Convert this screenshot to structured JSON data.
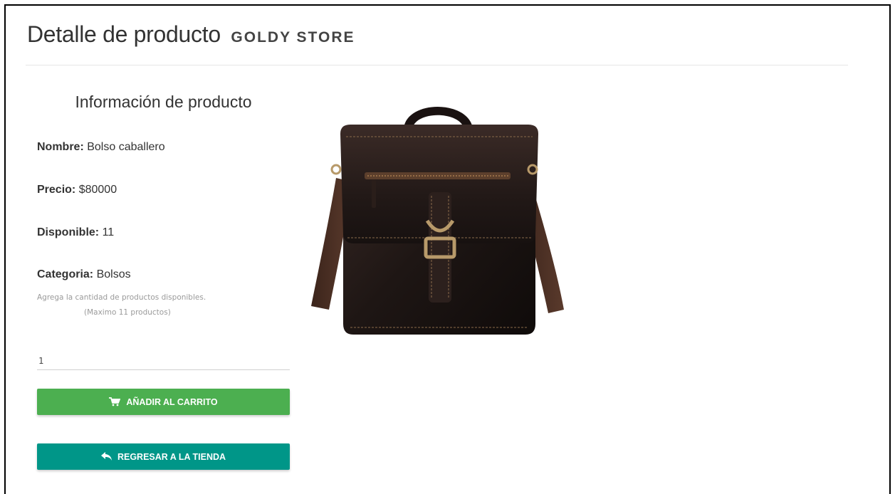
{
  "header": {
    "title": "Detalle de producto",
    "brand": "GOLDY STORE"
  },
  "info": {
    "section_title": "Información de producto",
    "nombre_label": "Nombre:",
    "nombre_value": "Bolso caballero",
    "precio_label": "Precio:",
    "precio_value": "$80000",
    "disponible_label": "Disponible:",
    "disponible_value": "11",
    "categoria_label": "Categoria:",
    "categoria_value": "Bolsos",
    "hint_line1": "Agrega la cantidad de productos disponibles.",
    "hint_line2": "(Maximo 11 productos)"
  },
  "quantity": {
    "value": "1"
  },
  "buttons": {
    "add_label": "AÑADIR AL CARRITO",
    "back_label": "REGRESAR A LA TIENDA",
    "add_icon": "cart-icon",
    "back_icon": "reply-arrow-icon",
    "add_color": "#4caf50",
    "back_color": "#009688"
  },
  "product_image": {
    "icon": "leather-messenger-bag"
  }
}
